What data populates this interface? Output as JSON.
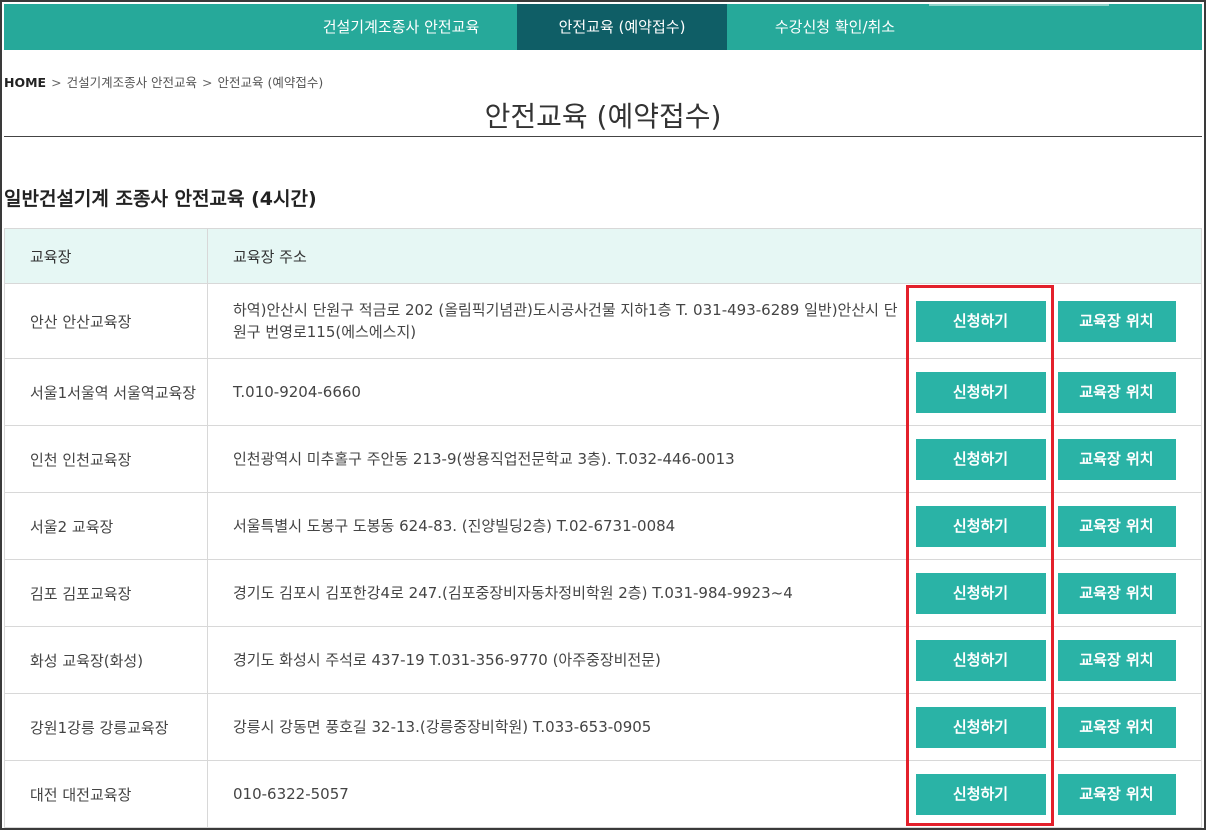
{
  "nav": {
    "tabs": [
      {
        "label": "건설기계조종사 안전교육"
      },
      {
        "label": "안전교육 (예약접수)"
      },
      {
        "label": "수강신청 확인/취소"
      }
    ]
  },
  "breadcrumb": {
    "home": "HOME",
    "sep": ">",
    "level1": "건설기계조종사 안전교육",
    "level2": "안전교육 (예약접수)"
  },
  "page_title": "안전교육 (예약접수)",
  "section_title": "일반건설기계 조종사 안전교육 (4시간)",
  "table": {
    "headers": [
      "교육장",
      "교육장 주소"
    ],
    "apply_label": "신청하기",
    "map_label": "교육장 위치",
    "rows": [
      {
        "name": "안산 안산교육장",
        "address": "하역)안산시 단원구 적금로 202 (올림픽기념관)도시공사건물 지하1층 T. 031-493-6289 일반)안산시 단원구 번영로115(에스에스지)"
      },
      {
        "name": "서울1서울역 서울역교육장",
        "address": "T.010-9204-6660"
      },
      {
        "name": "인천 인천교육장",
        "address": "인천광역시 미추홀구 주안동 213-9(쌍용직업전문학교 3층). T.032-446-0013"
      },
      {
        "name": "서울2 교육장",
        "address": "서울특별시 도봉구 도봉동 624-83. (진양빌딩2층) T.02-6731-0084"
      },
      {
        "name": "김포 김포교육장",
        "address": "경기도 김포시 김포한강4로 247.(김포중장비자동차정비학원 2층) T.031-984-9923~4"
      },
      {
        "name": "화성 교육장(화성)",
        "address": "경기도 화성시 주석로 437-19 T.031-356-9770 (아주중장비전문)"
      },
      {
        "name": "강원1강릉 강릉교육장",
        "address": "강릉시 강동면 풍호길 32-13.(강릉중장비학원) T.033-653-0905"
      },
      {
        "name": "대전 대전교육장",
        "address": "010-6322-5057"
      }
    ]
  },
  "colors": {
    "nav_bg": "#26a99a",
    "nav_active": "#0f5e66",
    "button": "#2ab3a6",
    "header_bg": "#e6f7f4",
    "highlight": "#e3202b"
  }
}
